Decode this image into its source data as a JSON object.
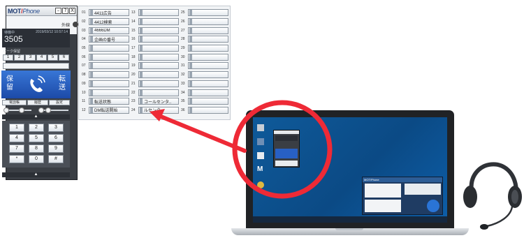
{
  "phone": {
    "logo_main": "MOT",
    "logo_slash": "/",
    "logo_sub": "Phone",
    "window_buttons": [
      "–",
      "?",
      "X"
    ],
    "outside_line_label": "外線",
    "status_label": "待機中",
    "datetime": "2019/03/12 10:57:14",
    "number": "3505",
    "park_label": "パーク保留",
    "park_slots": [
      "1",
      "2",
      "3",
      "4",
      "5",
      "6"
    ],
    "hold_label": "保留",
    "transfer_label": "転送",
    "function_buttons": [
      "電話帳",
      "履歴",
      "設定"
    ],
    "keypad": [
      "1",
      "2",
      "3",
      "4",
      "5",
      "6",
      "7",
      "8",
      "9",
      "*",
      "0",
      "#"
    ],
    "colors": {
      "accent": "#2860c4",
      "body": "#3a3e44"
    }
  },
  "grid": {
    "columns": [
      [
        {
          "num": "01",
          "label": "4411広告"
        },
        {
          "num": "02",
          "label": "4412検索"
        },
        {
          "num": "03",
          "label": "4666DM"
        },
        {
          "num": "04",
          "label": "企画の番号"
        },
        {
          "num": "05",
          "label": ""
        },
        {
          "num": "06",
          "label": ""
        },
        {
          "num": "07",
          "label": ""
        },
        {
          "num": "08",
          "label": ""
        },
        {
          "num": "09",
          "label": ""
        },
        {
          "num": "10",
          "label": ""
        },
        {
          "num": "11",
          "label": "転送状態"
        },
        {
          "num": "12",
          "label": "DM転送開始"
        }
      ],
      [
        {
          "num": "13",
          "label": ""
        },
        {
          "num": "14",
          "label": ""
        },
        {
          "num": "15",
          "label": ""
        },
        {
          "num": "16",
          "label": ""
        },
        {
          "num": "17",
          "label": ""
        },
        {
          "num": "18",
          "label": ""
        },
        {
          "num": "19",
          "label": ""
        },
        {
          "num": "20",
          "label": ""
        },
        {
          "num": "21",
          "label": ""
        },
        {
          "num": "22",
          "label": ""
        },
        {
          "num": "23",
          "label": "コールセンタ.."
        },
        {
          "num": "24",
          "label": "ルセンタ.."
        }
      ],
      [
        {
          "num": "25",
          "label": ""
        },
        {
          "num": "26",
          "label": ""
        },
        {
          "num": "27",
          "label": ""
        },
        {
          "num": "28",
          "label": ""
        },
        {
          "num": "29",
          "label": ""
        },
        {
          "num": "30",
          "label": ""
        },
        {
          "num": "31",
          "label": ""
        },
        {
          "num": "32",
          "label": ""
        },
        {
          "num": "33",
          "label": ""
        },
        {
          "num": "34",
          "label": ""
        },
        {
          "num": "35",
          "label": ""
        },
        {
          "num": "36",
          "label": ""
        }
      ]
    ]
  },
  "laptop": {
    "desktop_icon_letter": "M",
    "popup_title": "MOT/Phone"
  },
  "annotation": {
    "circle_color": "#ee2a36",
    "arrow_color": "#ee2a36"
  }
}
